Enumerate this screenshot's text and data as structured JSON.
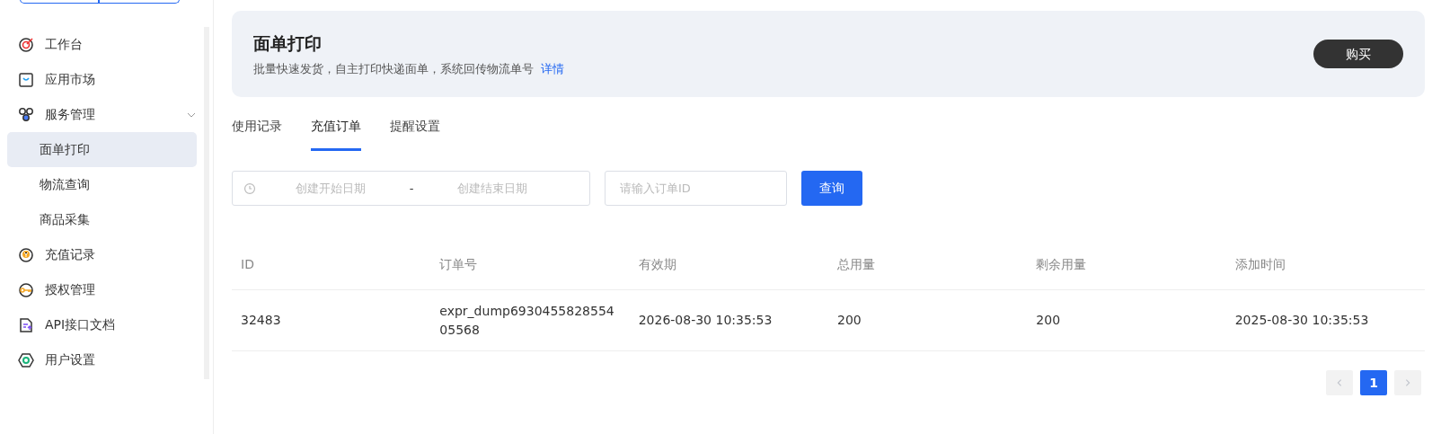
{
  "sidebar": {
    "items": [
      {
        "label": "工作台",
        "selected": false
      },
      {
        "label": "应用市场",
        "selected": false
      },
      {
        "label": "服务管理",
        "selected": false,
        "expanded": true,
        "children": [
          {
            "label": "面单打印",
            "selected": true
          },
          {
            "label": "物流查询",
            "selected": false
          },
          {
            "label": "商品采集",
            "selected": false
          }
        ]
      },
      {
        "label": "充值记录",
        "selected": false
      },
      {
        "label": "授权管理",
        "selected": false
      },
      {
        "label": "API接口文档",
        "selected": false
      },
      {
        "label": "用户设置",
        "selected": false
      }
    ]
  },
  "banner": {
    "title": "面单打印",
    "description": "批量快速发货，自主打印快递面单，系统回传物流单号",
    "link": "详情",
    "button": "购买"
  },
  "tabs": [
    {
      "label": "使用记录",
      "selected": false
    },
    {
      "label": "充值订单",
      "selected": true
    },
    {
      "label": "提醒设置",
      "selected": false
    }
  ],
  "filters": {
    "start_date": {
      "placeholder": "创建开始日期"
    },
    "separator": "-",
    "end_date": {
      "placeholder": "创建结束日期"
    },
    "order_id": {
      "placeholder": "请输入订单ID"
    },
    "button": "查询"
  },
  "table": {
    "columns": [
      "ID",
      "订单号",
      "有效期",
      "总用量",
      "剩余用量",
      "添加时间"
    ],
    "rows": [
      [
        "32483",
        "expr_dump693045582855405568",
        "2026-08-30 10:35:53",
        "200",
        "200",
        "2025-08-30 10:35:53"
      ]
    ]
  },
  "pagination": {
    "pages": [
      {
        "label": "1",
        "selected": true
      }
    ],
    "prev_disabled": true,
    "next_disabled": true
  }
}
